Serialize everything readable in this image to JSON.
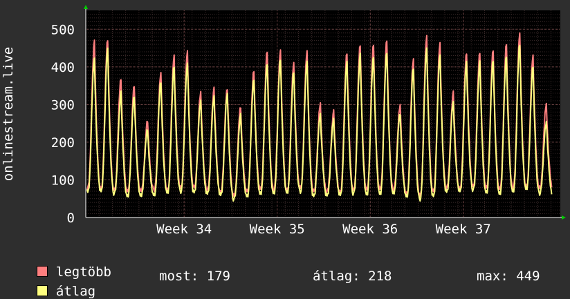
{
  "chart_data": {
    "type": "line",
    "ylabel": "onlinestream.live",
    "ylim": [
      0,
      550
    ],
    "yticks": [
      0,
      100,
      200,
      300,
      400,
      500
    ],
    "xticks": [
      "Week 34",
      "Week 35",
      "Week 36",
      "Week 37"
    ],
    "xlim_days": [
      0,
      35.7
    ],
    "xtick_days": [
      7.4,
      14.4,
      21.4,
      28.4
    ],
    "series": [
      {
        "name": "legtöbb",
        "color": "#ff7f7f",
        "daily_peaks": [
          465,
          475,
          370,
          350,
          255,
          385,
          430,
          440,
          330,
          340,
          345,
          295,
          390,
          440,
          445,
          410,
          440,
          300,
          280,
          440,
          460,
          460,
          470,
          300,
          420,
          480,
          460,
          330,
          440,
          440,
          445,
          460,
          490,
          430,
          300
        ],
        "daily_troughs": [
          80,
          80,
          75,
          70,
          70,
          75,
          75,
          80,
          80,
          75,
          70,
          60,
          70,
          75,
          75,
          75,
          80,
          70,
          70,
          70,
          75,
          75,
          75,
          75,
          65,
          60,
          70,
          80,
          80,
          85,
          80,
          75,
          80,
          85,
          80
        ]
      },
      {
        "name": "átlag",
        "color": "#ffff7f",
        "daily_peaks": [
          420,
          445,
          330,
          325,
          235,
          360,
          400,
          410,
          310,
          320,
          325,
          270,
          370,
          410,
          420,
          385,
          415,
          275,
          260,
          410,
          430,
          430,
          440,
          275,
          395,
          450,
          430,
          305,
          410,
          410,
          420,
          430,
          460,
          400,
          255
        ],
        "daily_troughs": [
          70,
          70,
          65,
          60,
          60,
          60,
          65,
          70,
          70,
          65,
          60,
          50,
          60,
          65,
          65,
          65,
          70,
          60,
          60,
          60,
          65,
          65,
          65,
          65,
          55,
          50,
          60,
          70,
          70,
          75,
          70,
          65,
          70,
          75,
          65
        ]
      }
    ],
    "legend": [
      {
        "label": "legtöbb",
        "color": "#ff7f7f"
      },
      {
        "label": "átlag",
        "color": "#ffff7f"
      }
    ],
    "stats": {
      "most": "most: 179",
      "atlag": "átlag: 218",
      "max": "max: 449"
    },
    "grid": true,
    "background": "#000000",
    "frame_color": "#2e2e2e",
    "grid_color": "#4a3a3a"
  }
}
